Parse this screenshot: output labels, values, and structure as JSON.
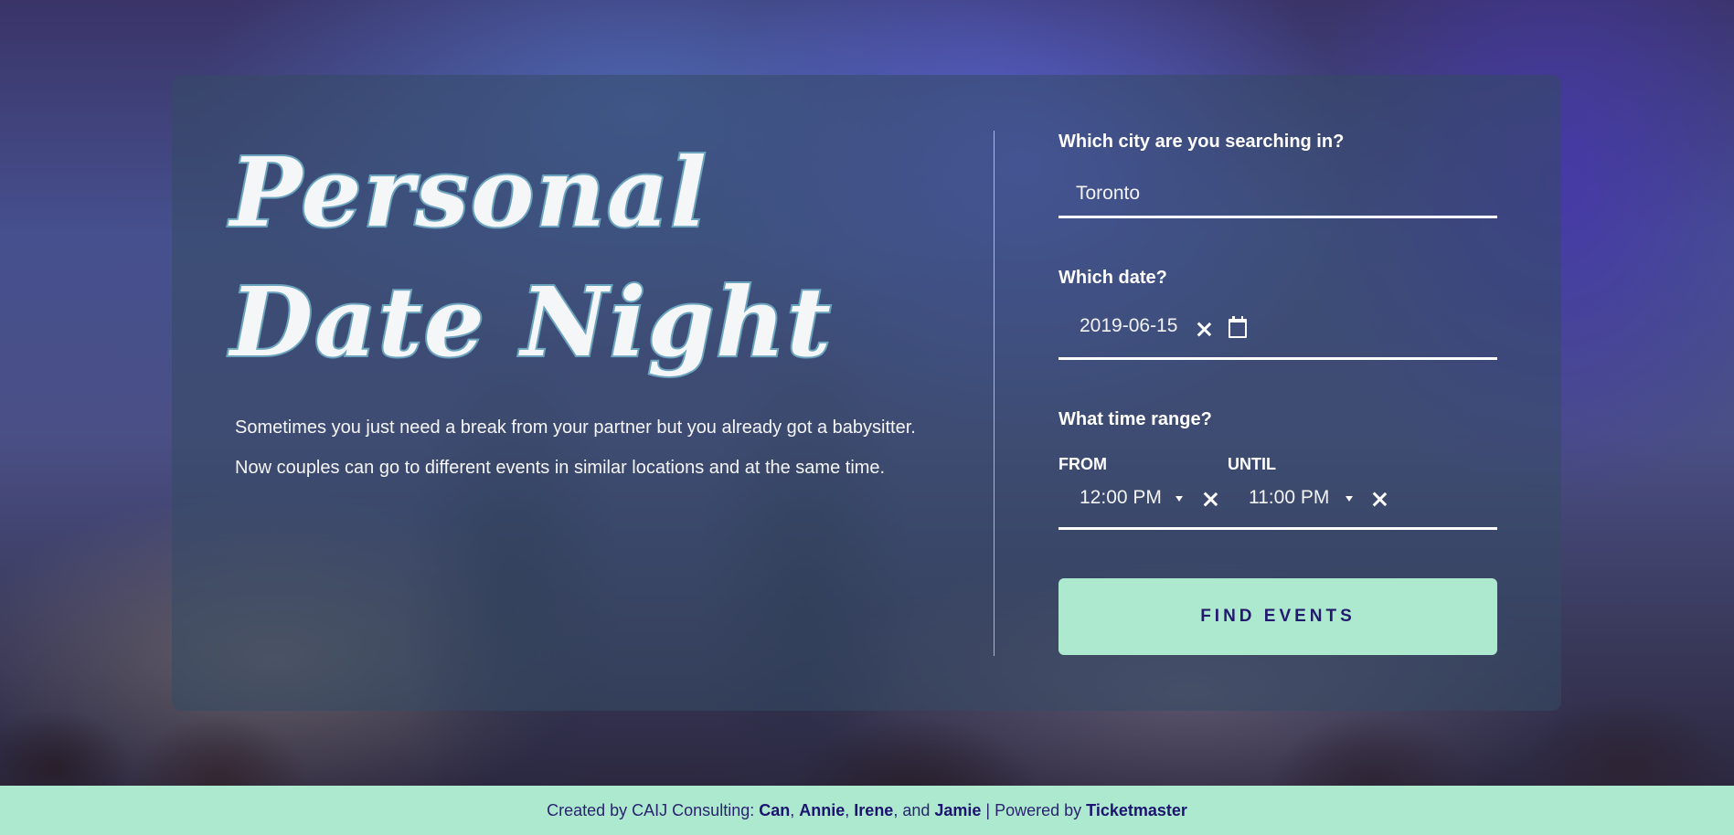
{
  "hero": {
    "title_line1": "Personal",
    "title_line2": "Date Night",
    "description": "Sometimes you just need a break from your partner but you already got a babysitter. Now couples can go to different events in similar locations and at the same time."
  },
  "form": {
    "city_label": "Which city are you searching in?",
    "city_value": "Toronto",
    "date_label": "Which date?",
    "date_value": "2019-06-15",
    "time_label": "What time range?",
    "from_label": "FROM",
    "from_value": "12:00  PM",
    "until_label": "UNTIL",
    "until_value": "11:00  PM",
    "submit_label": "FIND EVENTS"
  },
  "footer": {
    "created_prefix": "Created by CAIJ Consulting: ",
    "names": [
      "Can",
      "Annie",
      "Irene",
      "Jamie"
    ],
    "sep1": ", ",
    "sep2": ", ",
    "sep3": ", and ",
    "powered_prefix": " | Powered by ",
    "powered_by": "Ticketmaster"
  },
  "colors": {
    "accent": "#ade9cf",
    "button_text": "#231a6e",
    "title_stroke": "#6aa3bd"
  },
  "icons": [
    "clear-date-icon",
    "calendar-icon",
    "time-dropdown-caret-icon",
    "clear-time-icon"
  ]
}
